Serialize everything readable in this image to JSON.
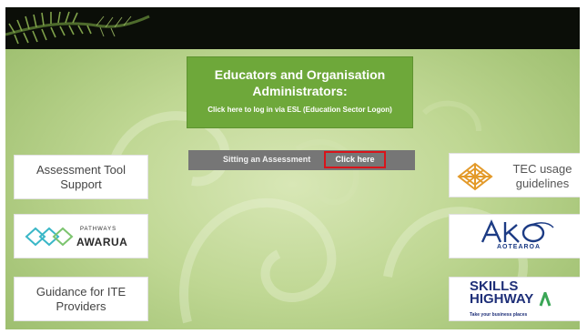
{
  "educators": {
    "title": "Educators and Organisation Administrators:",
    "subtitle": "Click here to log in via ESL (Education Sector Logon)"
  },
  "assessment": {
    "label": "Sitting an Assessment",
    "link": "Click here"
  },
  "left_tiles": {
    "support": "Assessment Tool Support",
    "pathways_small": "PATHWAYS",
    "awarua": "AWARUA",
    "guidance": "Guidance for ITE Providers"
  },
  "right_tiles": {
    "tec": "TEC usage guidelines",
    "aotearoa": "AOTEAROA",
    "skills": "SKILLS",
    "highway": "HIGHWAY",
    "highway_tag": "Take your business places"
  },
  "colors": {
    "accent_green": "#6ea83a",
    "highlight_red": "#d9141b",
    "ako_blue": "#1c3b84"
  }
}
